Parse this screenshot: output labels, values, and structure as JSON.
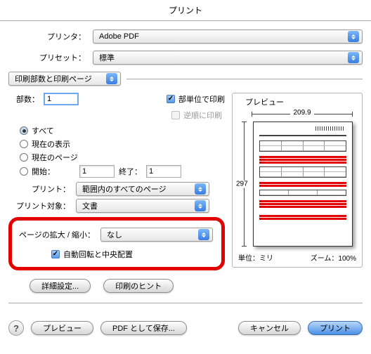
{
  "title": "プリント",
  "printer": {
    "label": "プリンタ：",
    "value": "Adobe PDF"
  },
  "preset": {
    "label": "プリセット：",
    "value": "標準"
  },
  "section_select": "印刷部数と印刷ページ",
  "copies": {
    "label": "部数：",
    "value": "1"
  },
  "collate": {
    "label": "部単位で印刷",
    "checked": true
  },
  "reverse": {
    "label": "逆順に印刷",
    "checked": false
  },
  "pages": {
    "all": "すべて",
    "current_view": "現在の表示",
    "current_page": "現在のページ",
    "from_label": "開始：",
    "from": "1",
    "to_label": "終了：",
    "to": "1",
    "selected": "all"
  },
  "print_scope": {
    "label": "プリント：",
    "value": "範囲内のすべてのページ"
  },
  "print_target": {
    "label": "プリント対象：",
    "value": "文書"
  },
  "scaling": {
    "label": "ページの拡大 / 縮小：",
    "value": "なし"
  },
  "auto_rotate": {
    "label": "自動回転と中央配置",
    "checked": true
  },
  "advanced": "詳細設定...",
  "hints": "印刷のヒント",
  "preview": {
    "title": "プレビュー",
    "width": "209.9",
    "height": "297",
    "units_label": "単位：ミリ",
    "zoom_label": "ズーム：100%"
  },
  "footer": {
    "help": "?",
    "preview": "プレビュー",
    "save_pdf": "PDF として保存...",
    "cancel": "キャンセル",
    "print": "プリント"
  }
}
